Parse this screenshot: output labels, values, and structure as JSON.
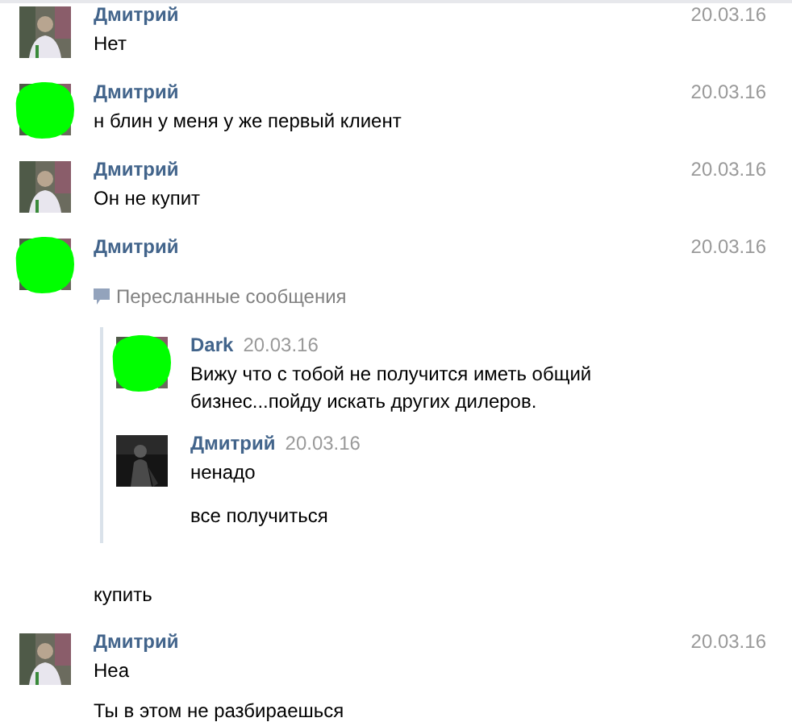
{
  "messages": [
    {
      "name": "Дмитрий",
      "date": "20.03.16",
      "avatar": {
        "kind": "picture",
        "covered": false
      },
      "texts": [
        "Нет"
      ]
    },
    {
      "name": "Дмитрий",
      "date": "20.03.16",
      "avatar": {
        "kind": "picture",
        "covered": true
      },
      "texts": [
        "н блин у меня у же первый клиент"
      ]
    },
    {
      "name": "Дмитрий",
      "date": "20.03.16",
      "avatar": {
        "kind": "picture",
        "covered": false
      },
      "texts": [
        "Он не купит"
      ]
    },
    {
      "name": "Дмитрий",
      "date": "20.03.16",
      "avatar": {
        "kind": "picture",
        "covered": true
      },
      "forwarded": {
        "label": "Пересланные сообщения",
        "messages": [
          {
            "name": "Dark",
            "date": "20.03.16",
            "avatar": {
              "kind": "picture",
              "covered": true
            },
            "texts": [
              "Вижу что с тобой не получится иметь общий бизнес...пойду искать других дилеров."
            ]
          },
          {
            "name": "Дмитрий",
            "date": "20.03.16",
            "avatar": {
              "kind": "picture",
              "covered": false,
              "dark": true
            },
            "texts": [
              "ненадо",
              "все получиться"
            ]
          }
        ]
      },
      "after": [
        "купить"
      ]
    },
    {
      "name": "Дмитрий",
      "date": "20.03.16",
      "avatar": {
        "kind": "picture",
        "covered": false
      },
      "texts": [
        "Неа",
        "Ты в этом не разбираешься"
      ]
    }
  ]
}
